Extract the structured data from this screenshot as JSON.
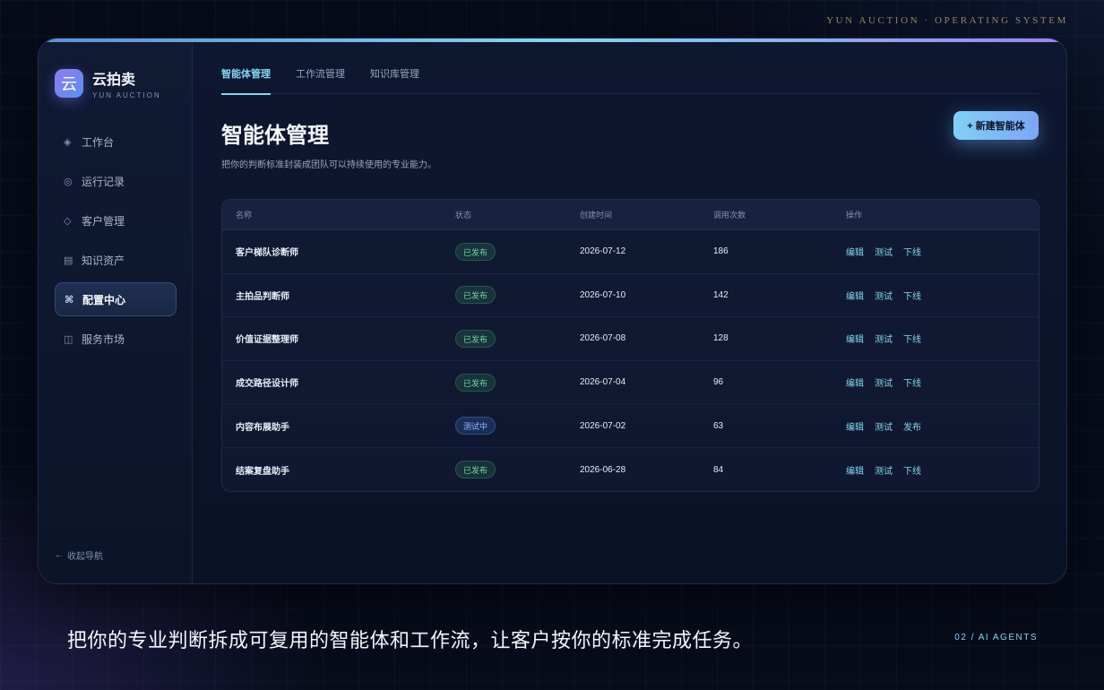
{
  "brand_top": "YUN AUCTION · OPERATING SYSTEM",
  "logo": {
    "mark": "云",
    "title": "云拍卖",
    "subtitle": "YUN AUCTION"
  },
  "sidebar": {
    "items": [
      {
        "icon": "◈",
        "label": "工作台"
      },
      {
        "icon": "◎",
        "label": "运行记录"
      },
      {
        "icon": "◇",
        "label": "客户管理"
      },
      {
        "icon": "▤",
        "label": "知识资产"
      },
      {
        "icon": "⌘",
        "label": "配置中心",
        "active": true
      },
      {
        "icon": "◫",
        "label": "服务市场"
      }
    ],
    "collapse": {
      "icon": "←",
      "label": "收起导航"
    }
  },
  "tabs": [
    {
      "label": "智能体管理",
      "active": true
    },
    {
      "label": "工作流管理"
    },
    {
      "label": "知识库管理"
    }
  ],
  "page": {
    "title": "智能体管理",
    "description": "把你的判断标准封装成团队可以持续使用的专业能力。",
    "new_button": "+ 新建智能体"
  },
  "table": {
    "headers": [
      "名称",
      "状态",
      "创建时间",
      "调用次数",
      "操作"
    ],
    "rows": [
      {
        "name": "客户梯队诊断师",
        "status": "已发布",
        "status_type": "published",
        "date": "2026-07-12",
        "calls": "186",
        "actions": [
          "编辑",
          "测试",
          "下线"
        ]
      },
      {
        "name": "主拍品判断师",
        "status": "已发布",
        "status_type": "published",
        "date": "2026-07-10",
        "calls": "142",
        "actions": [
          "编辑",
          "测试",
          "下线"
        ]
      },
      {
        "name": "价值证据整理师",
        "status": "已发布",
        "status_type": "published",
        "date": "2026-07-08",
        "calls": "128",
        "actions": [
          "编辑",
          "测试",
          "下线"
        ]
      },
      {
        "name": "成交路径设计师",
        "status": "已发布",
        "status_type": "published",
        "date": "2026-07-04",
        "calls": "96",
        "actions": [
          "编辑",
          "测试",
          "下线"
        ]
      },
      {
        "name": "内容布展助手",
        "status": "测试中",
        "status_type": "testing",
        "date": "2026-07-02",
        "calls": "63",
        "actions": [
          "编辑",
          "测试",
          "发布"
        ]
      },
      {
        "name": "结案复盘助手",
        "status": "已发布",
        "status_type": "published",
        "date": "2026-06-28",
        "calls": "84",
        "actions": [
          "编辑",
          "测试",
          "下线"
        ]
      }
    ]
  },
  "footer": {
    "tagline": "把你的专业判断拆成可复用的智能体和工作流，让客户按你的标准完成任务。",
    "page_num": "02 / AI AGENTS"
  },
  "colors": {
    "accent": "#7fd8f0",
    "published": "#6fd6a0",
    "testing": "#8fb8ff",
    "background": "#070c1a"
  }
}
